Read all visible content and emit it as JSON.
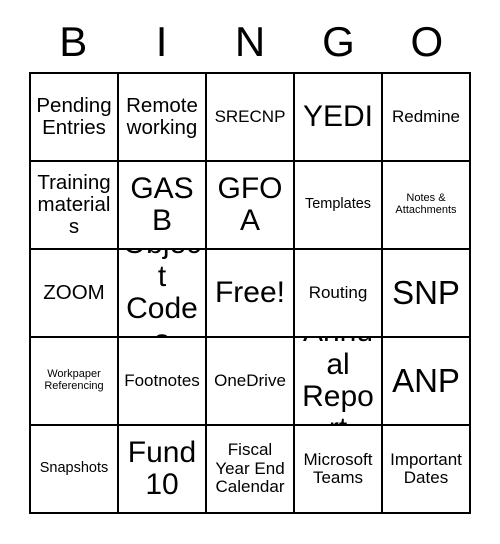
{
  "header": {
    "letters": [
      "B",
      "I",
      "N",
      "G",
      "O"
    ]
  },
  "grid": {
    "rows": 5,
    "columns": 5,
    "border_color": "#000000",
    "background_color": "#ffffff",
    "text_color": "#000000",
    "cells": [
      [
        {
          "text": "Pending Entries",
          "size": "lg"
        },
        {
          "text": "Remote working",
          "size": "lg"
        },
        {
          "text": "SRECNP",
          "size": "md"
        },
        {
          "text": "YEDI",
          "size": "xl"
        },
        {
          "text": "Redmine",
          "size": "md"
        }
      ],
      [
        {
          "text": "Training materials",
          "size": "lg"
        },
        {
          "text": "GASB",
          "size": "xl"
        },
        {
          "text": "GFOA",
          "size": "xl"
        },
        {
          "text": "Templates",
          "size": "sm"
        },
        {
          "text": "Notes & Attachments",
          "size": "xs"
        }
      ],
      [
        {
          "text": "ZOOM",
          "size": "lg"
        },
        {
          "text": "Object Codes",
          "size": "xl"
        },
        {
          "text": "Free!",
          "size": "xl"
        },
        {
          "text": "Routing",
          "size": "md"
        },
        {
          "text": "SNP",
          "size": "xxl"
        }
      ],
      [
        {
          "text": "Workpaper Referencing",
          "size": "xs"
        },
        {
          "text": "Footnotes",
          "size": "md"
        },
        {
          "text": "OneDrive",
          "size": "md"
        },
        {
          "text": "Annual Report",
          "size": "xl"
        },
        {
          "text": "ANP",
          "size": "xxl"
        }
      ],
      [
        {
          "text": "Snapshots",
          "size": "sm"
        },
        {
          "text": "Fund 10",
          "size": "xl"
        },
        {
          "text": "Fiscal Year End Calendar",
          "size": "md"
        },
        {
          "text": "Microsoft Teams",
          "size": "md"
        },
        {
          "text": "Important Dates",
          "size": "md"
        }
      ]
    ]
  }
}
